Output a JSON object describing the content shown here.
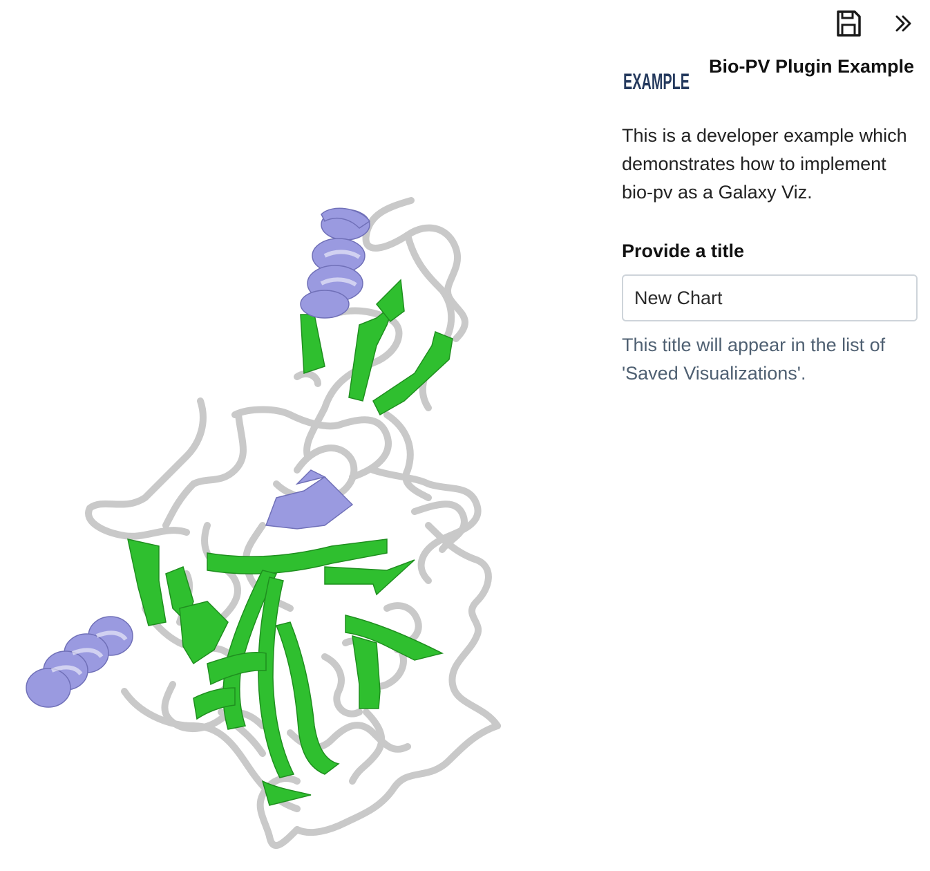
{
  "toolbar": {
    "save_icon": "floppy-disk-icon",
    "collapse_icon": "chevron-double-right-icon"
  },
  "plugin": {
    "logo_text": "EXAMPLE",
    "logo_color": "#253a5e",
    "title": "Bio-PV Plugin Example",
    "description": "This is a developer example which demonstrates how to implement bio-pv as a Galaxy Viz."
  },
  "form": {
    "title_label": "Provide a title",
    "title_value": "New Chart",
    "title_help": "This title will appear in the list of 'Saved Visualizations'."
  },
  "colors": {
    "coil": "#c9c9c9",
    "strand": "#2fbf2f",
    "helix": "#9a9ae0",
    "help_text": "#4f6072"
  }
}
